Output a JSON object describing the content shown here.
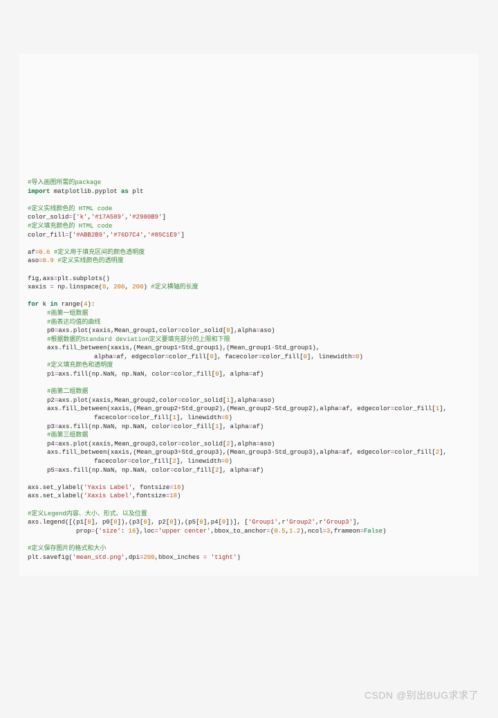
{
  "watermark": "CSDN @别出BUG求求了",
  "code": {
    "c1": "#导入画图所需的package",
    "l2a": "import",
    "l2b": " matplotlib.pyplot ",
    "l2c": "as",
    "l2d": " plt",
    "c3": "#定义实线颜色的 HTML code",
    "l4a": "color_solid",
    "l4b": "=",
    "l4c": "[",
    "l4d": "'k'",
    "l4e": ",",
    "l4f": "'#17A589'",
    "l4g": ",",
    "l4h": "'#2980B9'",
    "l4i": "]",
    "c5": "#定义填充颜色的 HTML code",
    "l6a": "color_fill",
    "l6b": "=",
    "l6c": "[",
    "l6d": "'#ABB2B9'",
    "l6e": ",",
    "l6f": "'#76D7C4'",
    "l6g": ",",
    "l6h": "'#85C1E9'",
    "l6i": "]",
    "l7a": "af",
    "l7b": "=",
    "l7c": "0.6",
    "l7d": " #定义用于填充区间的颜色透明度",
    "l8a": "aso",
    "l8b": "=",
    "l8c": "0.9",
    "l8d": " #定义实线颜色的透明度",
    "l9a": "fig,axs",
    "l9b": "=",
    "l9c": "plt.subplots()",
    "l10a": "xaxis ",
    "l10b": "=",
    "l10c": " np.linspace(",
    "l10d": "0",
    "l10e": ", ",
    "l10f": "200",
    "l10g": ", ",
    "l10h": "200",
    "l10i": ") ",
    "l10j": "#定义横轴的长度",
    "l11a": "for",
    "l11b": " k ",
    "l11c": "in",
    "l11d": " range(",
    "l11e": "4",
    "l11f": "):",
    "c12": "#画第一组数据",
    "c13": "#画表达均值的曲线",
    "l14a": "p0",
    "l14b": "=",
    "l14c": "axs.plot(xaxis,Mean_group1,color",
    "l14d": "=",
    "l14e": "color_solid[",
    "l14f": "0",
    "l14g": "],alpha",
    "l14h": "=",
    "l14i": "aso)",
    "c15": "#根据数据的Standard deviation定义要填充部分的上限和下限",
    "l16a": "axs.fill_between(xaxis,(Mean_group1",
    "l16b": "+",
    "l16c": "Std_group1),(Mean_group1",
    "l16d": "-",
    "l16e": "Std_group1),",
    "l17a": "alpha",
    "l17b": "=",
    "l17c": "af, edgecolor",
    "l17d": "=",
    "l17e": "color_fill[",
    "l17f": "0",
    "l17g": "], facecolor",
    "l17h": "=",
    "l17i": "color_fill[",
    "l17j": "0",
    "l17k": "], linewidth",
    "l17l": "=",
    "l17m": "0",
    "l17n": ")",
    "c18": "#定义填充颜色和透明度",
    "l19a": "p1",
    "l19b": "=",
    "l19c": "axs.fill(np.NaN, np.NaN, color",
    "l19d": "=",
    "l19e": "color_fill[",
    "l19f": "0",
    "l19g": "], alpha",
    "l19h": "=",
    "l19i": "af)",
    "c20": "#画第二组数据",
    "l21a": "p2",
    "l21b": "=",
    "l21c": "axs.plot(xaxis,Mean_group2,color",
    "l21d": "=",
    "l21e": "color_solid[",
    "l21f": "1",
    "l21g": "],alpha",
    "l21h": "=",
    "l21i": "aso)",
    "l22a": "axs.fill_between(xaxis,(Mean_group2",
    "l22b": "+",
    "l22c": "Std_group2),(Mean_group2",
    "l22d": "-",
    "l22e": "Std_group2),alpha",
    "l22f": "=",
    "l22g": "af, edgecolor",
    "l22h": "=",
    "l22i": "color_fill[",
    "l22j": "1",
    "l22k": "],",
    "l23a": "facecolor",
    "l23b": "=",
    "l23c": "color_fill[",
    "l23d": "1",
    "l23e": "], linewidth",
    "l23f": "=",
    "l23g": "0",
    "l23h": ")",
    "l24a": "p3",
    "l24b": "=",
    "l24c": "axs.fill(np.NaN, np.NaN, color",
    "l24d": "=",
    "l24e": "color_fill[",
    "l24f": "1",
    "l24g": "], alpha",
    "l24h": "=",
    "l24i": "af)",
    "c25": "#画第三组数据",
    "l26a": "p4",
    "l26b": "=",
    "l26c": "axs.plot(xaxis,Mean_group3,color",
    "l26d": "=",
    "l26e": "color_solid[",
    "l26f": "2",
    "l26g": "],alpha",
    "l26h": "=",
    "l26i": "aso)",
    "l27a": "axs.fill_between(xaxis,(Mean_group3",
    "l27b": "+",
    "l27c": "Std_group3),(Mean_group3",
    "l27d": "-",
    "l27e": "Std_group3),alpha",
    "l27f": "=",
    "l27g": "af, edgecolor",
    "l27h": "=",
    "l27i": "color_fill[",
    "l27j": "2",
    "l27k": "],",
    "l28a": "facecolor",
    "l28b": "=",
    "l28c": "color_fill[",
    "l28d": "2",
    "l28e": "], linewidth",
    "l28f": "=",
    "l28g": "0",
    "l28h": ")",
    "l29a": "p5",
    "l29b": "=",
    "l29c": "axs.fill(np.NaN, np.NaN, color",
    "l29d": "=",
    "l29e": "color_fill[",
    "l29f": "2",
    "l29g": "], alpha",
    "l29h": "=",
    "l29i": "af)",
    "l30a": "axs.set_ylabel(",
    "l30b": "'Yaxis Label'",
    "l30c": ", fontsize",
    "l30d": "=",
    "l30e": "18",
    "l30f": ")",
    "l31a": "axs.set_xlabel(",
    "l31b": "'Xaxis Label'",
    "l31c": ",fontsize",
    "l31d": "=",
    "l31e": "18",
    "l31f": ")",
    "c32": "#定义Legend内容、大小、形式、以及位置",
    "l33a": "axs.legend([(p1[",
    "l33b": "0",
    "l33c": "], p0[",
    "l33d": "0",
    "l33e": "]),(p3[",
    "l33f": "0",
    "l33g": "], p2[",
    "l33h": "0",
    "l33i": "]),(p5[",
    "l33j": "0",
    "l33k": "],p4[",
    "l33l": "0",
    "l33m": "])], [",
    "l33n": "'Group1'",
    "l33o": ",r",
    "l33p": "'Group2'",
    "l33q": ",r",
    "l33r": "'Group3'",
    "l33s": "],",
    "l34a": "prop",
    "l34b": "=",
    "l34c": "{",
    "l34d": "'size'",
    "l34e": ": ",
    "l34f": "16",
    "l34g": "},loc",
    "l34h": "=",
    "l34i": "'upper center'",
    "l34j": ",bbox_to_anchor",
    "l34k": "=",
    "l34l": "(",
    "l34m": "0.5",
    "l34n": ",",
    "l34o": "1.2",
    "l34p": "),ncol",
    "l34q": "=",
    "l34r": "3",
    "l34s": ",frameon",
    "l34t": "=",
    "l34u": "False",
    "l34v": ")",
    "c35": "#定义保存图片的格式和大小",
    "l36a": "plt.savefig(",
    "l36b": "'mean_std.png'",
    "l36c": ",dpi",
    "l36d": "=",
    "l36e": "200",
    "l36f": ",bbox_inches ",
    "l36g": "=",
    "l36h": " ",
    "l36i": "'tight'",
    "l36j": ")"
  }
}
